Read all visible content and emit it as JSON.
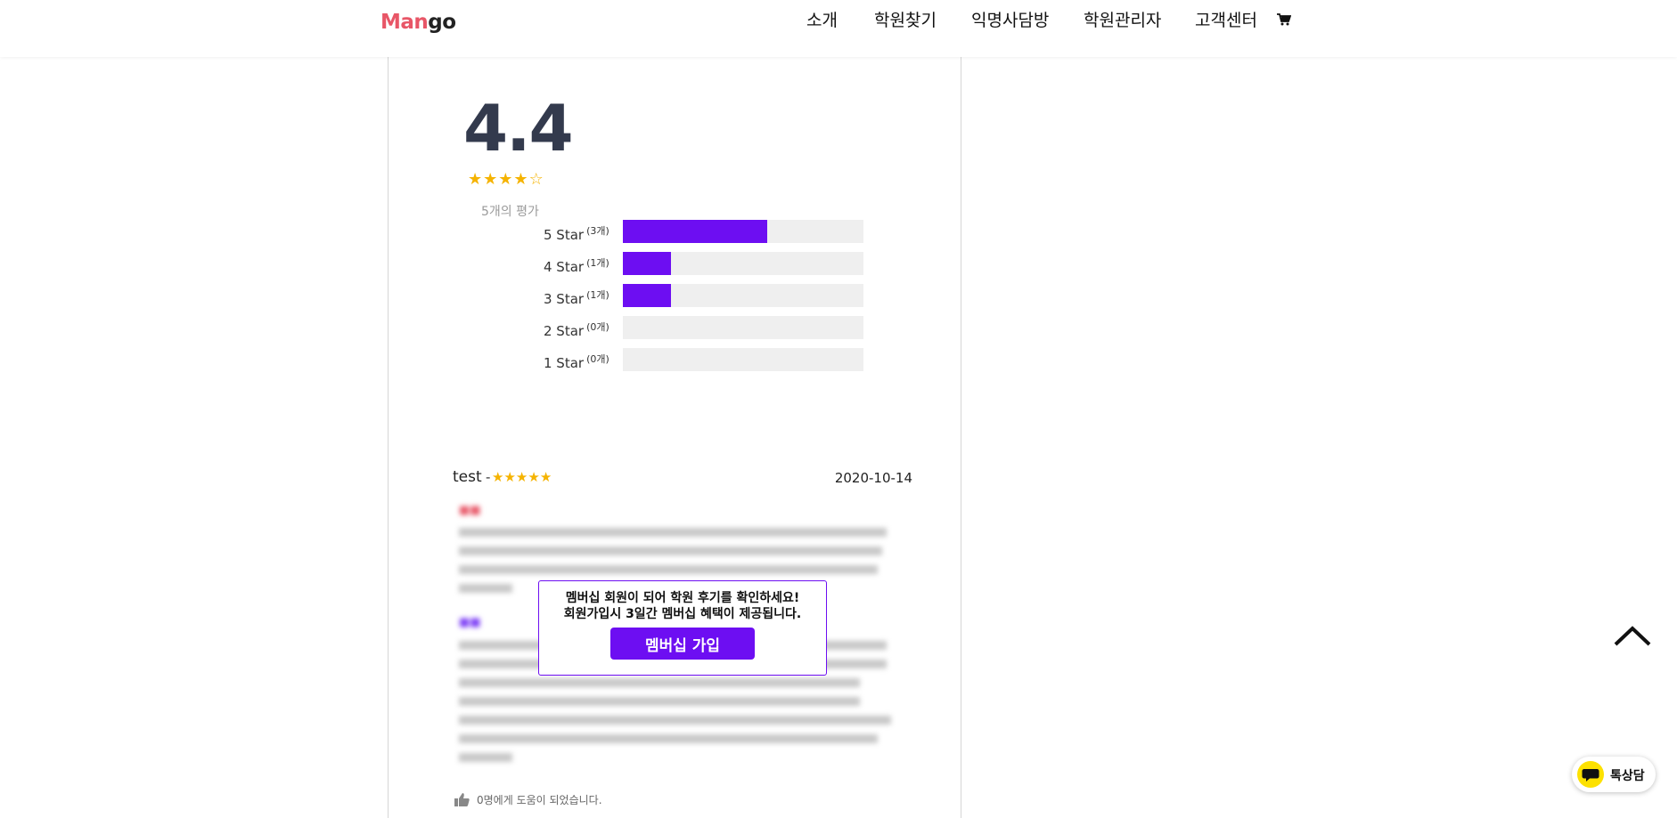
{
  "header": {
    "logo_part1": "Man",
    "logo_part2": "go",
    "nav": [
      "소개",
      "학원찾기",
      "익명사담방",
      "학원관리자",
      "고객센터"
    ],
    "cart_icon": "cart-icon"
  },
  "rating": {
    "average": "4.4",
    "stars": 4,
    "max_stars": 5,
    "count_text": "5개의 평가",
    "breakdown": [
      {
        "label": "5 Star",
        "count": "(3개)",
        "fraction": 0.6
      },
      {
        "label": "4 Star",
        "count": "(1개)",
        "fraction": 0.2
      },
      {
        "label": "3 Star",
        "count": "(1개)",
        "fraction": 0.2
      },
      {
        "label": "2 Star",
        "count": "(0개)",
        "fraction": 0.0
      },
      {
        "label": "1 Star",
        "count": "(0개)",
        "fraction": 0.0
      }
    ]
  },
  "review": {
    "user": "test",
    "separator": "-",
    "stars": 5,
    "date": "2020-10-14",
    "helpful_text": "0명에게 도움이 되었습니다."
  },
  "popup": {
    "line1": "멤버십 회원이 되어 학원 후기를 확인하세요!",
    "line2": "회원가입시 3일간 멤버십 혜택이 제공됩니다.",
    "button": "멤버십 가입"
  },
  "chat": {
    "label": "톡상담"
  },
  "colors": {
    "accent": "#6d0ef2",
    "logo_red": "#e85667",
    "star": "#f5b301",
    "chat_yellow": "#fde100"
  }
}
